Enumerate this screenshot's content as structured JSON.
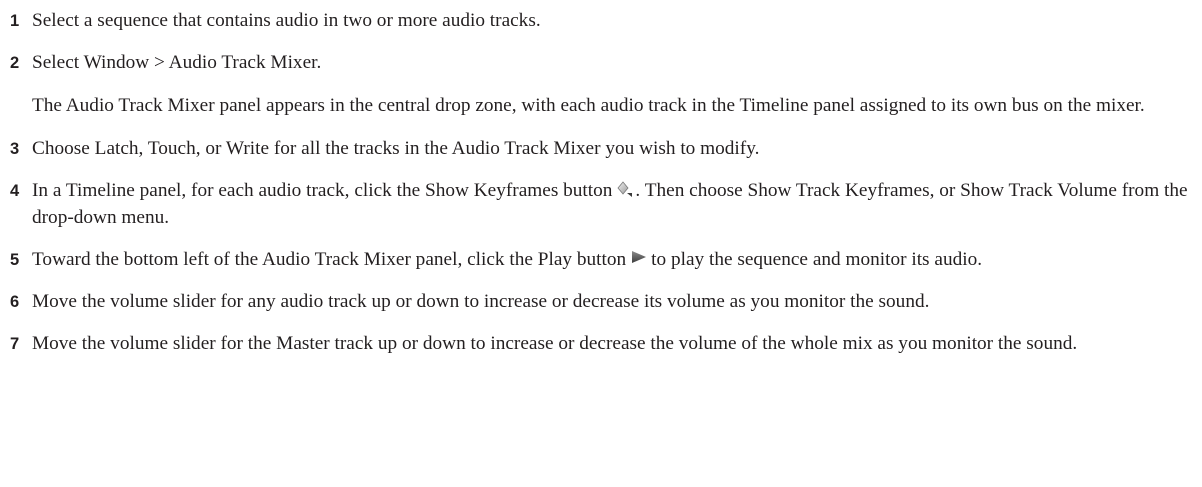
{
  "steps": [
    {
      "num": "1",
      "text": "Select a sequence that contains audio in two or more audio tracks."
    },
    {
      "num": "2",
      "text": "Select Window > Audio Track Mixer."
    },
    {
      "num": "3",
      "text": "Choose Latch, Touch, or Write for all the tracks in the Audio Track Mixer you wish to modify."
    },
    {
      "num": "4",
      "text_before": "In a Timeline panel, for each audio track, click the Show Keyframes button",
      "text_after": ". Then choose Show Track Keyframes, or Show Track Volume from the drop-down menu.",
      "icon": "show-keyframes-icon"
    },
    {
      "num": "5",
      "text_before": "Toward the bottom left of the Audio Track Mixer panel, click the Play button",
      "text_after": "to play the sequence and monitor its audio.",
      "icon": "play-icon"
    },
    {
      "num": "6",
      "text": "Move the volume slider for any audio track up or down to increase or decrease its volume as you monitor the sound."
    },
    {
      "num": "7",
      "text": "Move the volume slider for the Master track up or down to increase or decrease the volume of the whole mix as you monitor the sound."
    }
  ],
  "note_after_step_2": "The Audio Track Mixer panel appears in the central drop zone, with each audio track in the Timeline panel assigned to its own bus on the mixer."
}
